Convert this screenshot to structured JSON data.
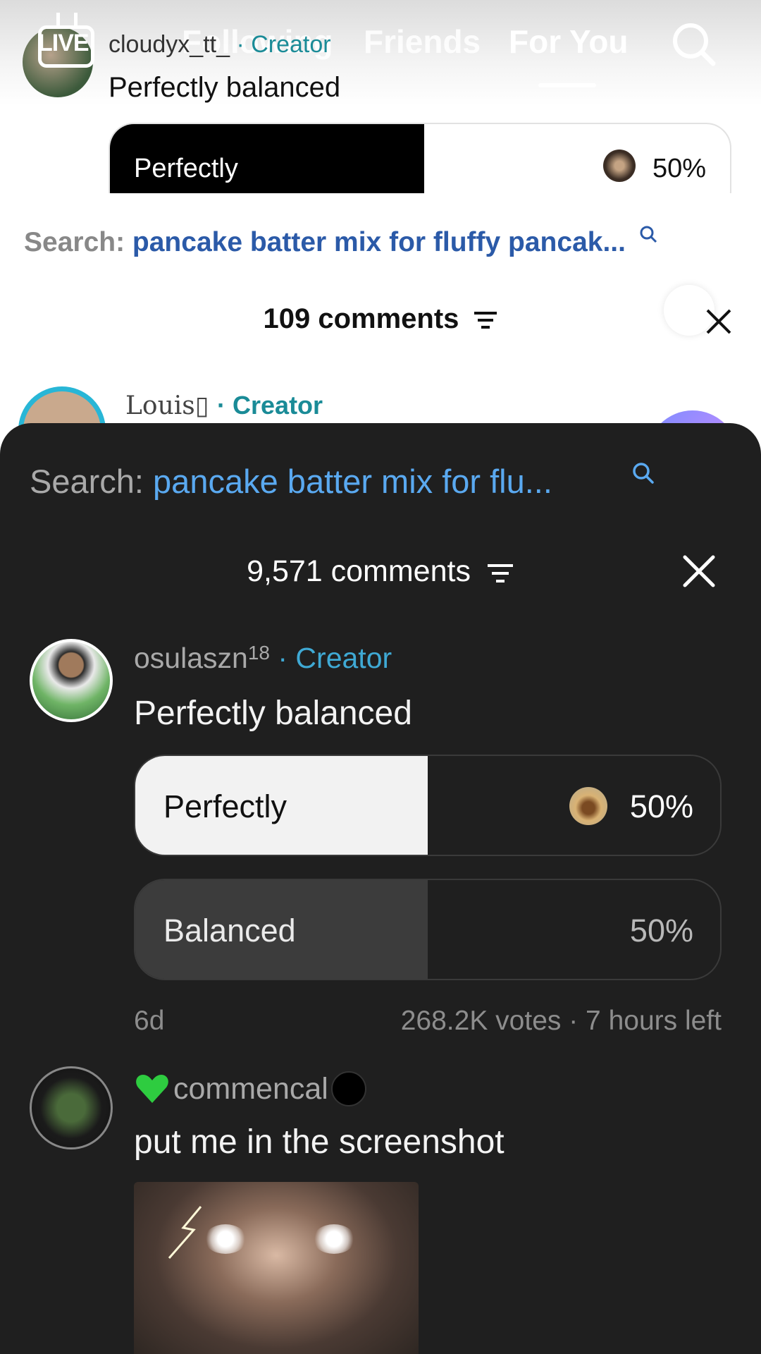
{
  "background": {
    "live_badge": "LIVE",
    "nav_tabs": [
      "Following",
      "Friends",
      "For You"
    ],
    "username": "cloudyx_tt_",
    "creator_tag": "· Creator",
    "comment_text": "Perfectly balanced",
    "poll_option": "Perfectly",
    "poll_percent": "50%",
    "search_label": "Search:",
    "search_query": "pancake batter mix for fluffy pancak...",
    "comments_count": "109 comments",
    "next_user": "Louis▯",
    "next_creator_tag": "· Creator"
  },
  "sheet": {
    "search_label": "Search:",
    "search_query": "pancake batter mix for flu...",
    "comments_count": "9,571 comments",
    "comment1": {
      "username": "osulaszn",
      "username_sup": "18",
      "creator_tag": "· Creator",
      "text": "Perfectly balanced",
      "poll": [
        {
          "label": "Perfectly",
          "percent": "50%",
          "share": 0.5,
          "selected": true
        },
        {
          "label": "Balanced",
          "percent": "50%",
          "share": 0.5,
          "selected": false
        }
      ],
      "age": "6d",
      "votes_info": "268.2K votes · 7 hours left"
    },
    "comment2": {
      "username": "commencal",
      "text": "put me in the screenshot"
    }
  },
  "colors": {
    "sheet_bg": "#1f1f1f",
    "accent_blue": "#5aa9f0",
    "creator_blue": "#3fa9d4",
    "heart_green": "#2ecc40"
  }
}
